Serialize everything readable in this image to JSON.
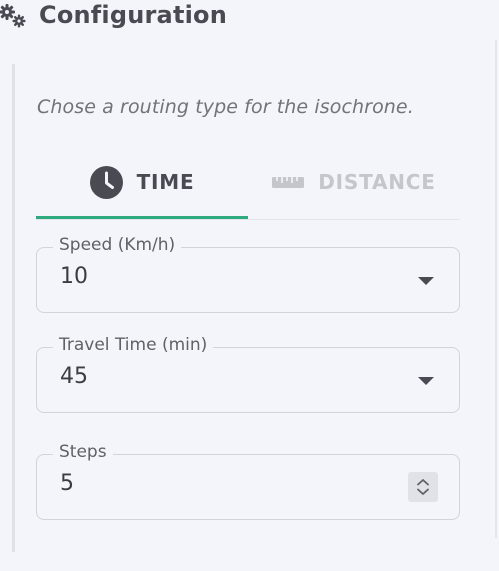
{
  "header": {
    "title": "Configuration",
    "icon": "gears-icon"
  },
  "hint": "Chose a routing type for the isochrone.",
  "tabs": [
    {
      "label": "TIME",
      "icon": "clock-icon",
      "selected": true
    },
    {
      "label": "DISTANCE",
      "icon": "ruler-icon",
      "selected": false
    }
  ],
  "fields": {
    "speed": {
      "label": "Speed (Km/h)",
      "value": "10",
      "control": "select"
    },
    "travel_time": {
      "label": "Travel Time (min)",
      "value": "45",
      "control": "select"
    },
    "steps": {
      "label": "Steps",
      "value": "5",
      "control": "number"
    }
  },
  "colors": {
    "accent": "#2eaa7f",
    "background": "#f4f5fa",
    "text": "#3c3c44",
    "muted": "#c4c6cc"
  }
}
